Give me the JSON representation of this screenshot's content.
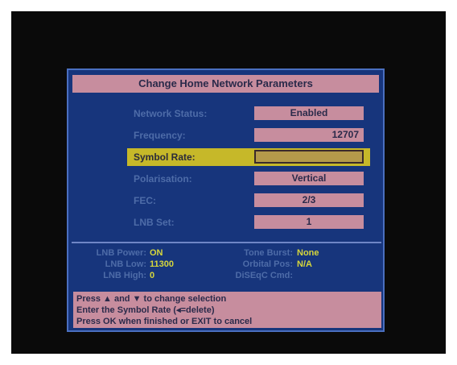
{
  "dialog": {
    "title": "Change Home Network Parameters"
  },
  "params": [
    {
      "label": "Network Status:",
      "value": "Enabled"
    },
    {
      "label": "Frequency:",
      "value": "12707"
    },
    {
      "label": "Symbol Rate:",
      "value": ""
    },
    {
      "label": "Polarisation:",
      "value": "Vertical"
    },
    {
      "label": "FEC:",
      "value": "2/3"
    },
    {
      "label": "LNB Set:",
      "value": "1"
    }
  ],
  "status": {
    "lnb_power_label": "LNB Power:",
    "lnb_power_value": "ON",
    "lnb_low_label": "LNB Low:",
    "lnb_low_value": "11300",
    "lnb_high_label": "LNB High:",
    "lnb_high_value": "0",
    "tone_burst_label": "Tone Burst:",
    "tone_burst_value": "None",
    "orbital_pos_label": "Orbital Pos:",
    "orbital_pos_value": "N/A",
    "diseqc_label": "DiSEqC Cmd:",
    "diseqc_value": ""
  },
  "help": [
    "Press ▲ and ▼ to change selection",
    "Enter the Symbol Rate (◂=delete)",
    "Press OK when finished or EXIT to cancel"
  ],
  "colors": {
    "panel": "#17357c",
    "field": "#c78d9e",
    "highlight": "#c6b829",
    "value_text": "#d6d63c"
  }
}
